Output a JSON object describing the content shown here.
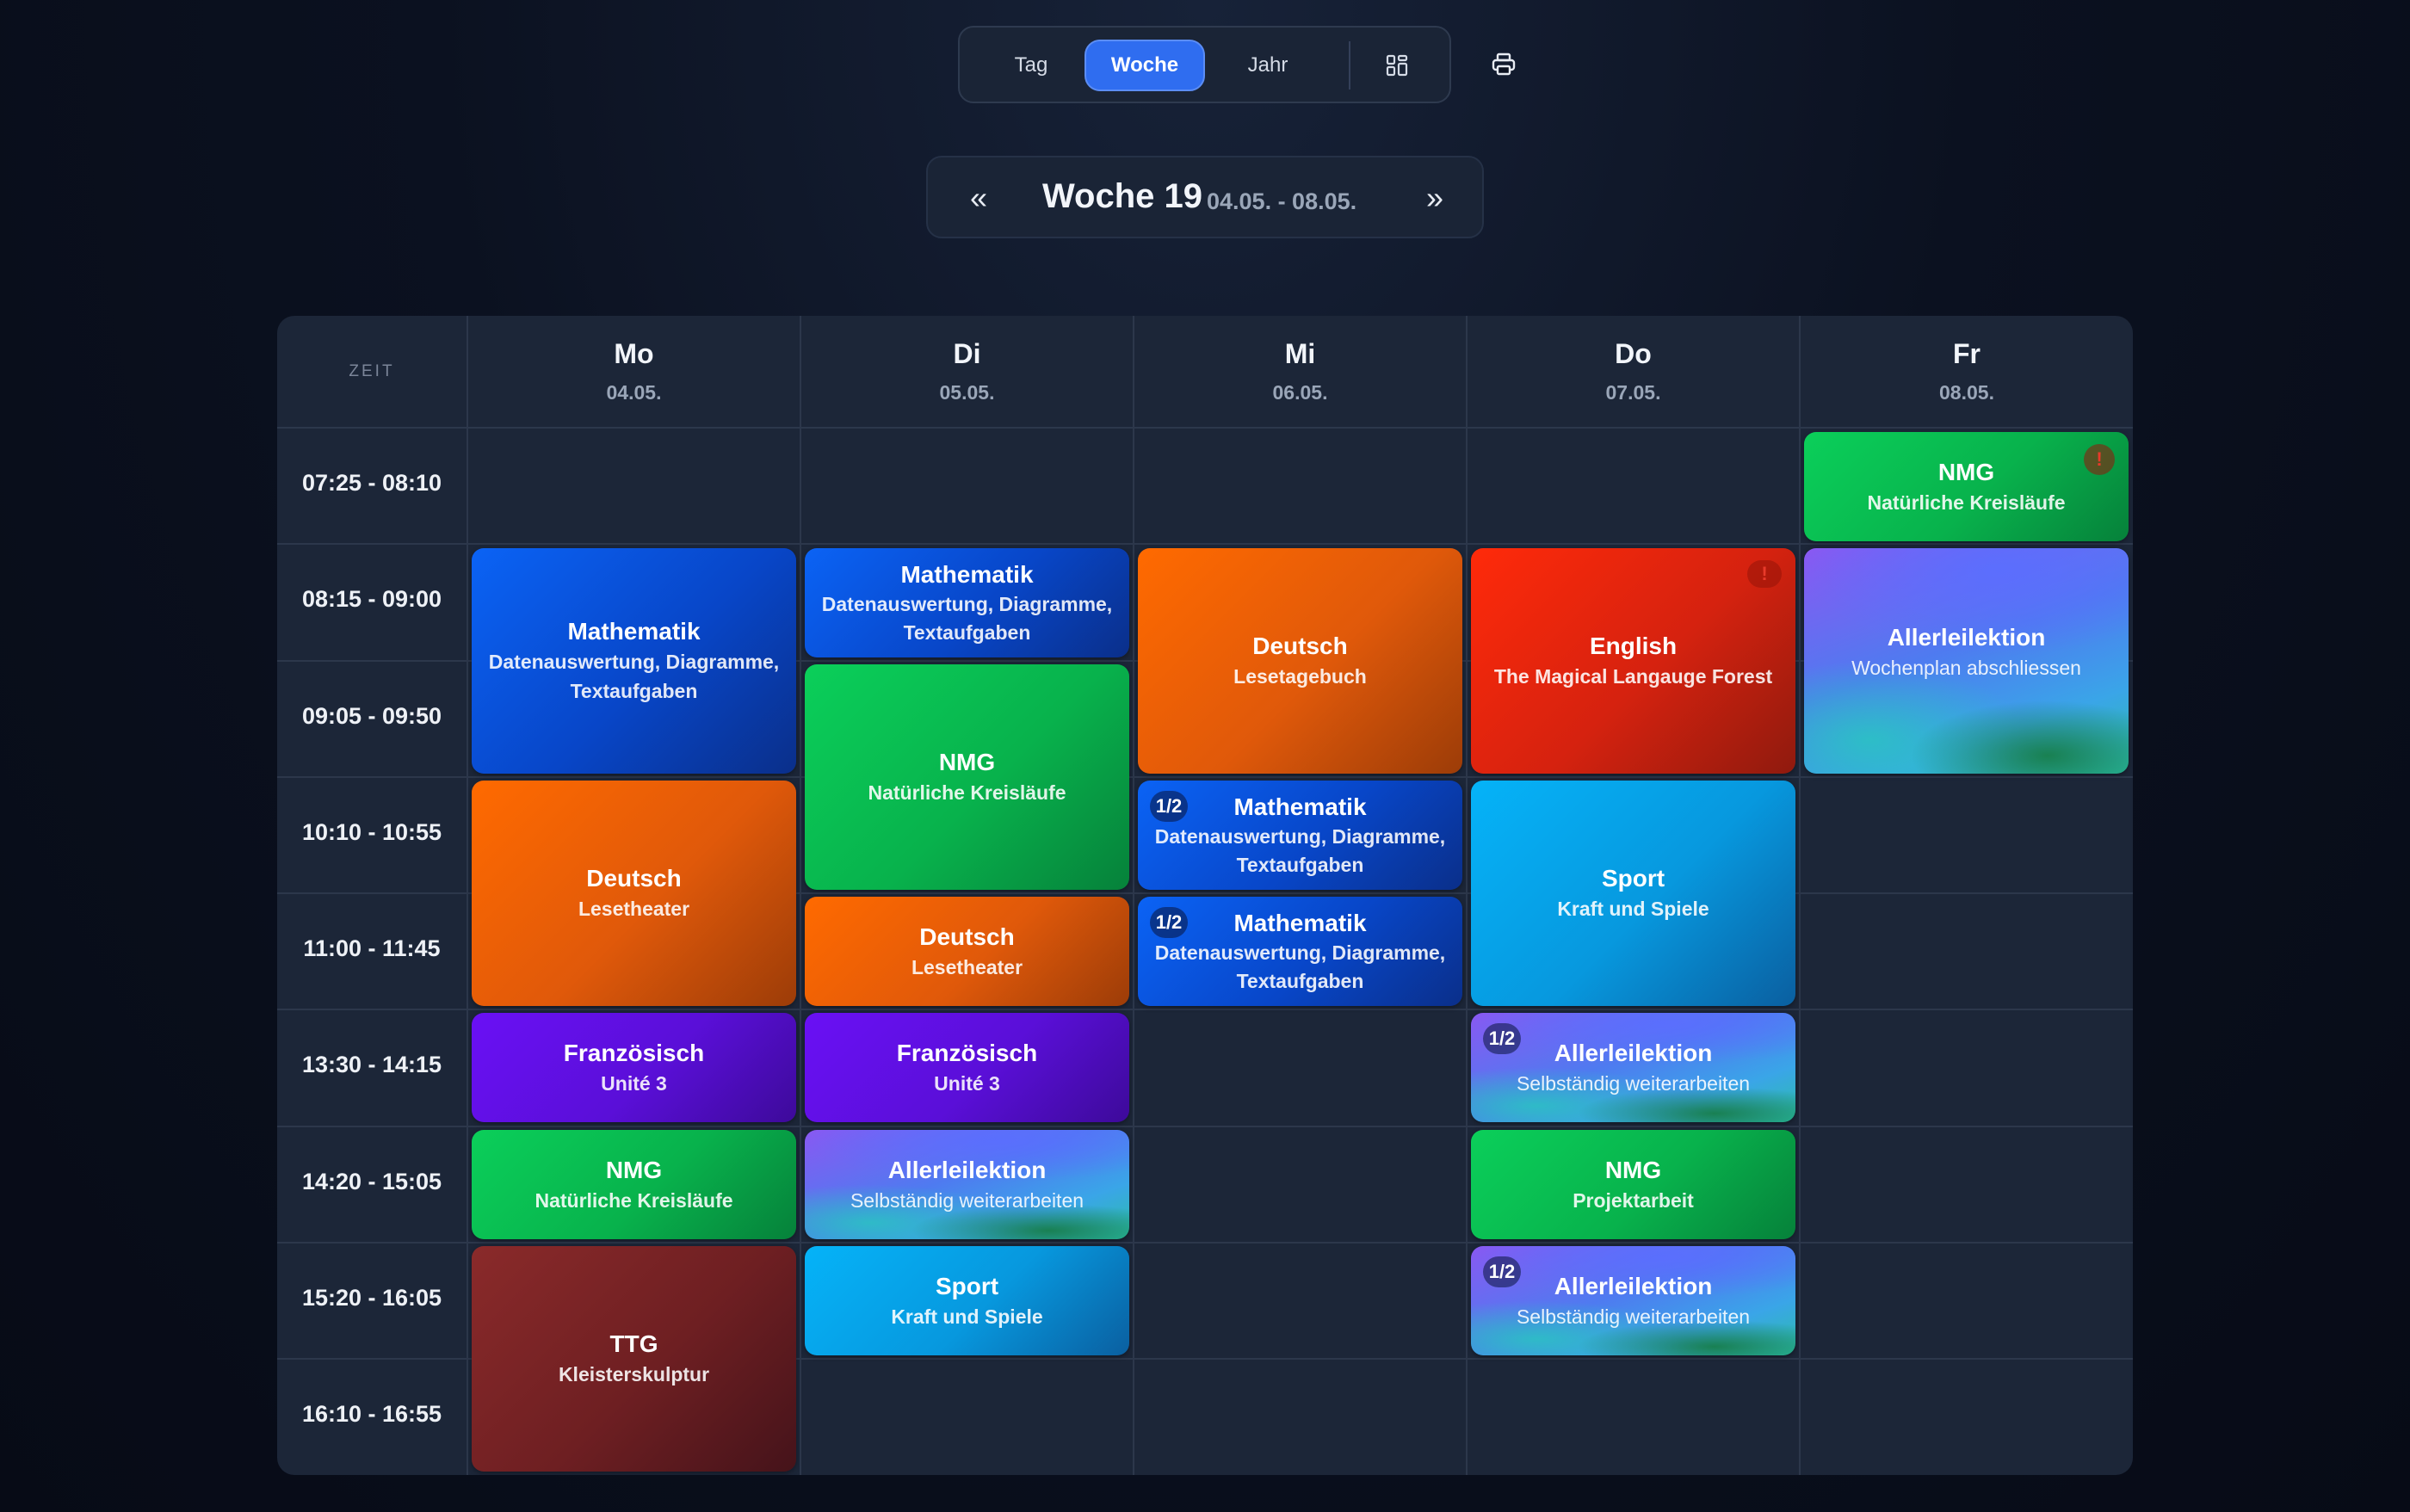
{
  "toolbar": {
    "views": [
      {
        "label": "Tag",
        "active": false
      },
      {
        "label": "Woche",
        "active": true
      },
      {
        "label": "Jahr",
        "active": false
      }
    ],
    "icons": [
      "grid-icon",
      "print-icon"
    ]
  },
  "week_nav": {
    "prev": "«",
    "title": "Woche 19",
    "range": "04.05. - 08.05.",
    "next": "»"
  },
  "calendar": {
    "time_header": "ZEIT",
    "days": [
      {
        "name": "Mo",
        "date": "04.05."
      },
      {
        "name": "Di",
        "date": "05.05."
      },
      {
        "name": "Mi",
        "date": "06.05."
      },
      {
        "name": "Do",
        "date": "07.05."
      },
      {
        "name": "Fr",
        "date": "08.05."
      }
    ],
    "times": [
      "07:25 - 08:10",
      "08:15 - 09:00",
      "09:05 - 09:50",
      "10:10 - 10:55",
      "11:00 - 11:45",
      "13:30 - 14:15",
      "14:20 - 15:05",
      "15:20 - 16:05",
      "16:10 - 16:55"
    ],
    "events": [
      {
        "day": 0,
        "start": 1,
        "span": 2,
        "title": "Mathematik",
        "subtitle": "Datenauswertung, Diagramme, Textaufgaben",
        "color": "blue"
      },
      {
        "day": 0,
        "start": 3,
        "span": 2,
        "title": "Deutsch",
        "subtitle": "Lesetheater",
        "color": "orange"
      },
      {
        "day": 0,
        "start": 5,
        "span": 1,
        "title": "Französisch",
        "subtitle": "Unité 3",
        "color": "purple"
      },
      {
        "day": 0,
        "start": 6,
        "span": 1,
        "title": "NMG",
        "subtitle": "Natürliche Kreisläufe",
        "color": "green"
      },
      {
        "day": 0,
        "start": 7,
        "span": 2,
        "title": "TTG",
        "subtitle": "Kleisterskulptur",
        "color": "maroon"
      },
      {
        "day": 1,
        "start": 1,
        "span": 1,
        "title": "Mathematik",
        "subtitle": "Datenauswertung, Diagramme, Textaufgaben",
        "color": "blue"
      },
      {
        "day": 1,
        "start": 2,
        "span": 2,
        "title": "NMG",
        "subtitle": "Natürliche Kreisläufe",
        "color": "green"
      },
      {
        "day": 1,
        "start": 4,
        "span": 1,
        "title": "Deutsch",
        "subtitle": "Lesetheater",
        "color": "orange"
      },
      {
        "day": 1,
        "start": 5,
        "span": 1,
        "title": "Französisch",
        "subtitle": "Unité 3",
        "color": "purple"
      },
      {
        "day": 1,
        "start": 6,
        "span": 1,
        "title": "Allerleilektion",
        "subtitle": "Selbständig weiterarbeiten",
        "color": "aurora"
      },
      {
        "day": 1,
        "start": 7,
        "span": 1,
        "title": "Sport",
        "subtitle": "Kraft und Spiele",
        "color": "sky"
      },
      {
        "day": 2,
        "start": 1,
        "span": 2,
        "title": "Deutsch",
        "subtitle": "Lesetagebuch",
        "color": "orange"
      },
      {
        "day": 2,
        "start": 3,
        "span": 1,
        "title": "Mathematik",
        "subtitle": "Datenauswertung, Diagramme, Textaufgaben",
        "color": "blue",
        "badge": "1/2"
      },
      {
        "day": 2,
        "start": 4,
        "span": 1,
        "title": "Mathematik",
        "subtitle": "Datenauswertung, Diagramme, Textaufgaben",
        "color": "blue",
        "badge": "1/2"
      },
      {
        "day": 3,
        "start": 1,
        "span": 2,
        "title": "English",
        "subtitle": "The Magical Langauge Forest",
        "color": "red",
        "alert": "!"
      },
      {
        "day": 3,
        "start": 3,
        "span": 2,
        "title": "Sport",
        "subtitle": "Kraft und Spiele",
        "color": "sky"
      },
      {
        "day": 3,
        "start": 5,
        "span": 1,
        "title": "Allerleilektion",
        "subtitle": "Selbständig weiterarbeiten",
        "color": "aurora",
        "badge": "1/2"
      },
      {
        "day": 3,
        "start": 6,
        "span": 1,
        "title": "NMG",
        "subtitle": "Projektarbeit",
        "color": "green"
      },
      {
        "day": 3,
        "start": 7,
        "span": 1,
        "title": "Allerleilektion",
        "subtitle": "Selbständig weiterarbeiten",
        "color": "aurora",
        "badge": "1/2"
      },
      {
        "day": 4,
        "start": 0,
        "span": 1,
        "title": "NMG",
        "subtitle": "Natürliche Kreisläufe",
        "color": "green",
        "alert": "!"
      },
      {
        "day": 4,
        "start": 1,
        "span": 2,
        "title": "Allerleilektion",
        "subtitle": "Wochenplan abschliessen",
        "color": "aurora"
      }
    ]
  }
}
